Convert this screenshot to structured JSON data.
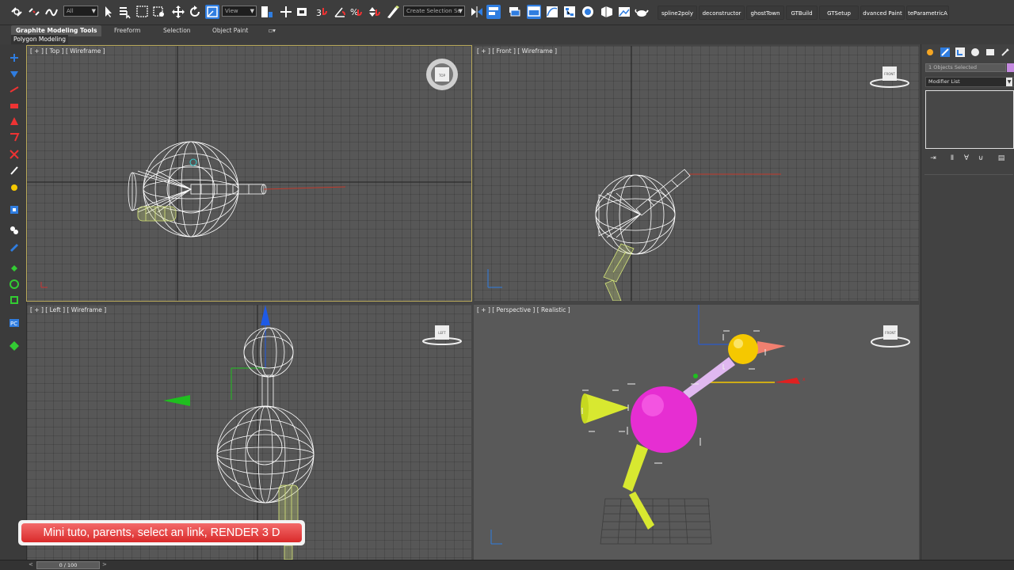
{
  "toolbar": {
    "selection_filter": "All",
    "reference_coord": "View",
    "named_selection": "Create Selection Se",
    "scripts": [
      "spline2poly",
      "deconstructor",
      "ghostTown",
      "GTBuild",
      "GTSetup",
      "dvanced Paint",
      "teParametricA"
    ],
    "icons": [
      "select-link-icon",
      "unlink-icon",
      "bind-spacewarp-icon",
      "select-object-icon",
      "select-by-name-icon",
      "rect-select-region-icon",
      "window-crossing-icon",
      "move-icon",
      "rotate-icon",
      "scale-icon",
      "use-pivot-icon",
      "manipulate-icon",
      "keyboard-shortcut-icon",
      "snap-toggle-icon",
      "angle-snap-icon",
      "percent-snap-icon",
      "spinner-snap-icon",
      "edit-named-selections-icon",
      "mirror-icon",
      "align-icon",
      "layer-manager-icon",
      "ribbon-toggle-icon",
      "curve-editor-icon",
      "schematic-view-icon",
      "material-editor-icon",
      "render-setup-icon",
      "rendered-frame-icon",
      "render-icon",
      "teapot-render-icon"
    ]
  },
  "ribbon": {
    "tabs": [
      "Graphite Modeling Tools",
      "Freeform",
      "Selection",
      "Object Paint"
    ],
    "active_tab": "Graphite Modeling Tools",
    "extra": "▫▾",
    "subtitle": "Polygon Modeling"
  },
  "viewports": [
    {
      "name": "top",
      "label": "[ + ] [ Top ] [ Wireframe ]"
    },
    {
      "name": "front",
      "label": "[ + ] [ Front ] [ Wireframe ]"
    },
    {
      "name": "left",
      "label": "[ + ] [ Left ] [ Wireframe ]"
    },
    {
      "name": "perspective",
      "label": "[ + ] [ Perspective ] [ Realistic ]"
    }
  ],
  "viewcube": {
    "top": "TOP",
    "front": "FRONT",
    "left": "LEFT",
    "persp": "FRONT"
  },
  "command_panel": {
    "selection_text": "1 Objects Selected",
    "swatch_color": "#c58ae0",
    "modifier_list": "Modifier List",
    "tab_icons": [
      "create-icon",
      "modify-icon",
      "hierarchy-icon",
      "motion-icon",
      "display-icon",
      "utilities-icon"
    ],
    "stack_icons": [
      "pin-stack-icon",
      "show-end-result-icon",
      "make-unique-icon",
      "remove-modifier-icon",
      "configure-modifier-sets-icon"
    ]
  },
  "time_slider": {
    "prev": "<",
    "value": "0 / 100",
    "next": ">"
  },
  "caption": "Mini tuto, parents, select an link, RENDER 3 D",
  "colors": {
    "accent_blue": "#2f7de0",
    "wire_white": "#ffffff",
    "wire_yellow": "#d7e87a",
    "axis_red": "#c0392b",
    "sphere_magenta": "#e62ed2",
    "sphere_yellow": "#f5c800"
  }
}
